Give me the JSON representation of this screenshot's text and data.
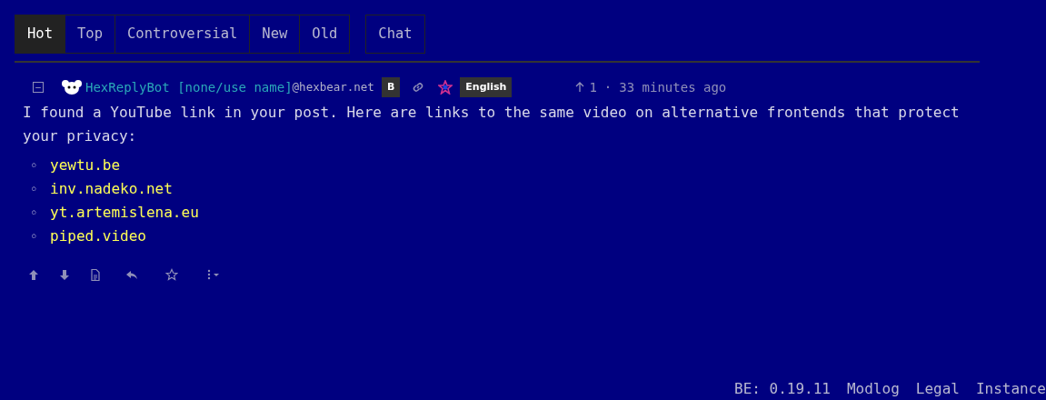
{
  "sort_tabs": [
    {
      "label": "Hot",
      "selected": true
    },
    {
      "label": "Top",
      "selected": false
    },
    {
      "label": "Controversial",
      "selected": false
    },
    {
      "label": "New",
      "selected": false
    },
    {
      "label": "Old",
      "selected": false
    }
  ],
  "chat_tab": {
    "label": "Chat",
    "selected": false
  },
  "comment": {
    "collapse_icon": "−",
    "username": "HexReplyBot [none/use name]",
    "instance": "@hexbear.net",
    "bot_badge": "B",
    "language": "English",
    "score": "1",
    "separator": "·",
    "time": "33 minutes ago",
    "body": "I found a YouTube link in your post. Here are links to the same video on alternative frontends that protect your privacy:",
    "links": [
      {
        "bullet": "◦",
        "text": "yewtu.be"
      },
      {
        "bullet": "◦",
        "text": "inv.nadeko.net"
      },
      {
        "bullet": "◦",
        "text": "yt.artemislena.eu"
      },
      {
        "bullet": "◦",
        "text": "piped.video"
      }
    ]
  },
  "footer": [
    "BE: 0.19.11",
    "Modlog",
    "Legal",
    "Instance"
  ]
}
